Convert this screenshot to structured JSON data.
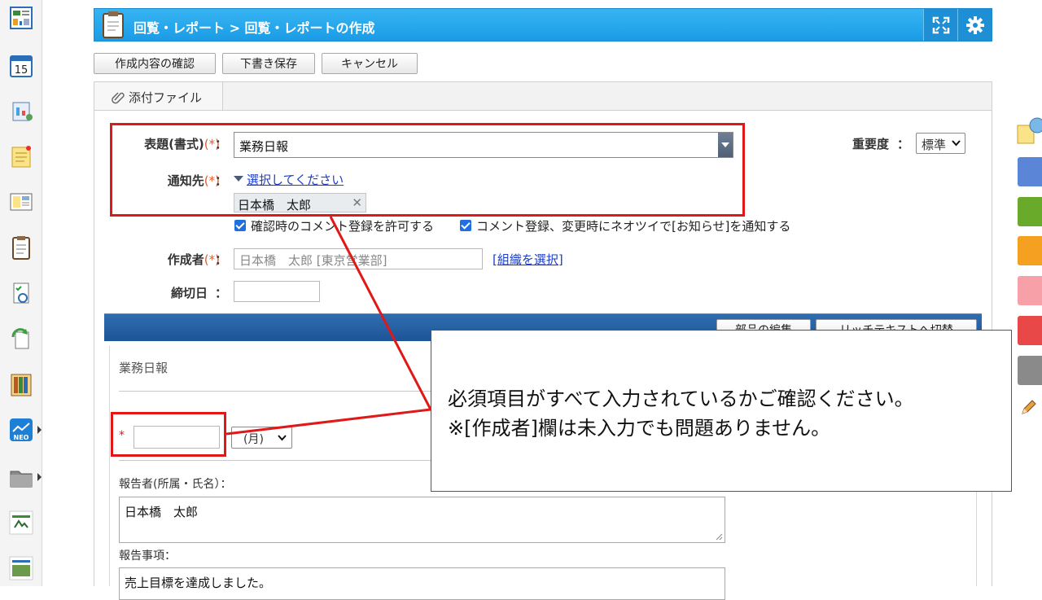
{
  "header": {
    "breadcrumb": "回覧・レポート > 回覧・レポートの作成"
  },
  "toolbar": {
    "confirm_label": "作成内容の確認",
    "draft_label": "下書き保存",
    "cancel_label": "キャンセル"
  },
  "attachment": {
    "label": "添付ファイル"
  },
  "form": {
    "subject_label": "表題(書式)",
    "required_mark": "(*)",
    "colon": "：",
    "subject_value": "業務日報",
    "importance_label": "重要度",
    "importance_value": "標準",
    "notify_label": "通知先",
    "notify_link": "選択してください",
    "notify_chip": "日本橋　太郎",
    "allow_comment_label": "確認時のコメント登録を許可する",
    "notify_comment_label": "コメント登録、変更時にネオツイで[お知らせ]を通知する",
    "author_label": "作成者",
    "author_placeholder": "日本橋　太郎 [東京営業部]",
    "org_link": "[組織を選択]",
    "deadline_label": "締切日"
  },
  "editor": {
    "parts_edit_label": "部品の編集",
    "richtext_label": "リッチテキストへ切替",
    "doc_title": "業務日報",
    "date_required_mark": "*",
    "weekday_value": "(月)",
    "reporter_label": "報告者(所属・氏名）：",
    "reporter_value": "日本橋　太郎",
    "report_label": "報告事項：",
    "report_value": "売上目標を達成しました。"
  },
  "callout": {
    "line1": "必須項目がすべて入力されているかご確認ください。",
    "line2": "※[作成者]欄は未入力でも問題ありません。"
  },
  "colors": {
    "header": "#1a9ce6",
    "annotation": "#e01818",
    "editor_bar": "#1d5597",
    "required": "#e55a2a",
    "link": "#1a3dcc"
  },
  "icons": {
    "dock": [
      "portal-icon",
      "calendar-icon",
      "facility-icon",
      "memo-icon",
      "bulletin-icon",
      "circular-report-icon",
      "search-report-icon",
      "workflow-icon",
      "cabinet-icon",
      "neo-icon",
      "folder-icon",
      "app-icon-1",
      "app-icon-2"
    ],
    "calendar_day": "15"
  }
}
